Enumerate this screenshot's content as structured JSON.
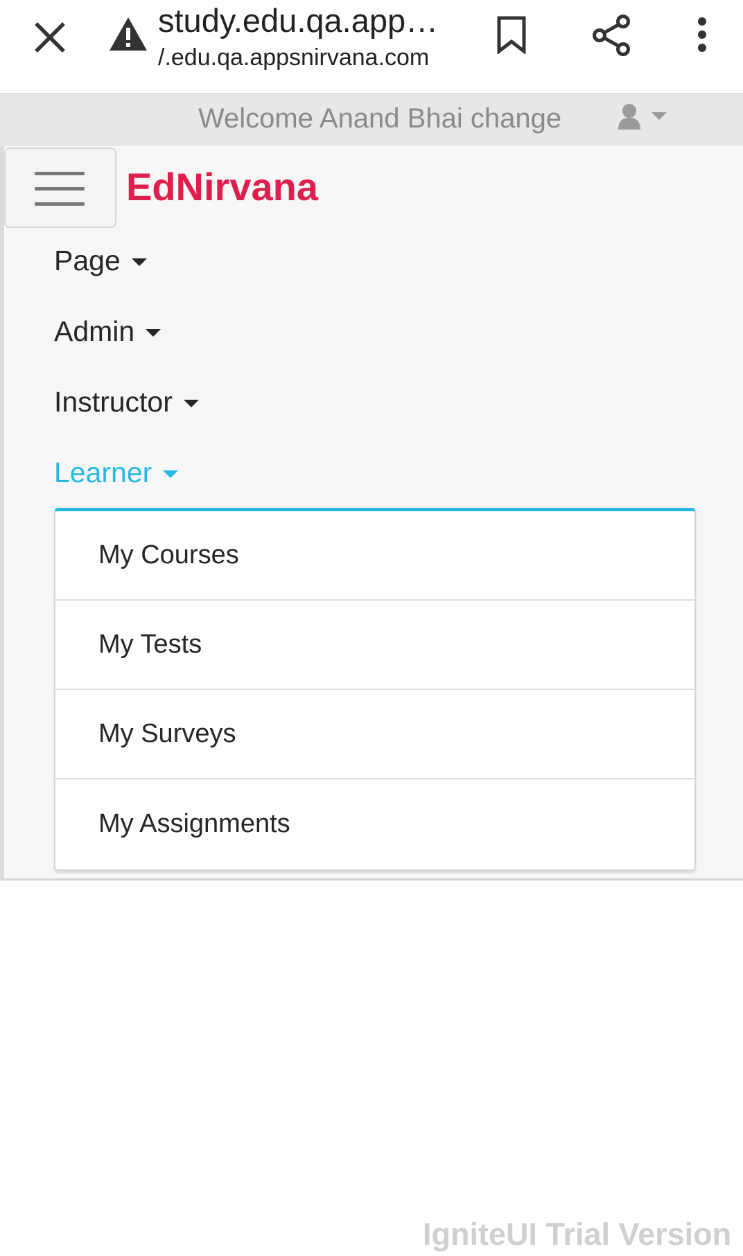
{
  "browser": {
    "url_title": "study.edu.qa.app…",
    "url_host": "/.edu.qa.appsnirvana.com"
  },
  "welcome_bar": {
    "text": "Welcome Anand Bhai change"
  },
  "brand": "EdNirvana",
  "nav": {
    "items": [
      {
        "label": "Page"
      },
      {
        "label": "Admin"
      },
      {
        "label": "Instructor"
      },
      {
        "label": "Learner",
        "active": true
      }
    ]
  },
  "learner_menu": {
    "items": [
      {
        "label": "My Courses"
      },
      {
        "label": "My Tests"
      },
      {
        "label": "My Surveys"
      },
      {
        "label": "My Assignments"
      }
    ]
  },
  "watermark": "IgniteUI Trial Version",
  "colors": {
    "brand": "#de1f4d",
    "accent": "#27b8e0",
    "welcome_bar_bg": "#e7e7e7"
  }
}
